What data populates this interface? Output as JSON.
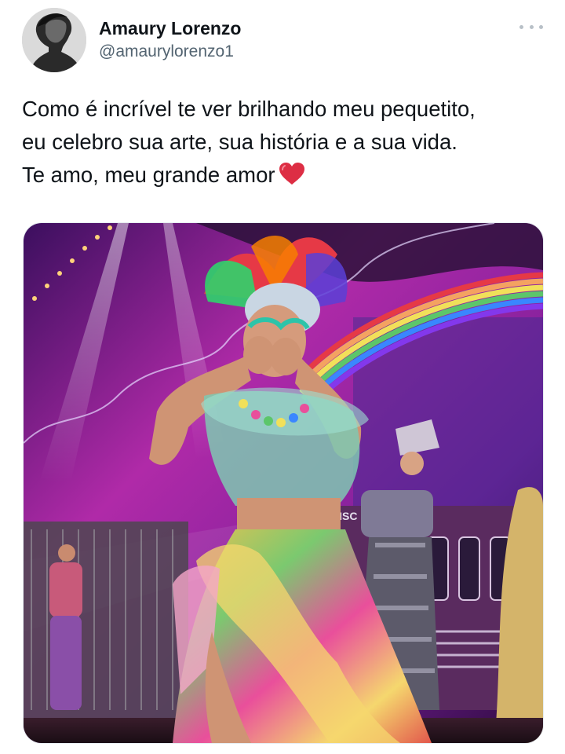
{
  "author": {
    "display_name": "Amaury Lorenzo",
    "handle": "@amaurylorenzo1",
    "avatar_icon": "profile-photo"
  },
  "more_icon": "more-horizontal-icon",
  "tweet": {
    "lines": [
      "Como é incrível te ver brilhando meu pequetito,",
      "eu celebro sua arte, sua história e a sua vida.",
      "Te amo, meu grande amor"
    ],
    "emoji": "red-heart"
  },
  "media": {
    "stage_sign": "RISC",
    "colors": {
      "background": "#6b1d8a",
      "rainbow": [
        "#e63946",
        "#f4a261",
        "#f1e05a",
        "#5cc66a",
        "#3a86ff",
        "#8338ec"
      ]
    }
  }
}
